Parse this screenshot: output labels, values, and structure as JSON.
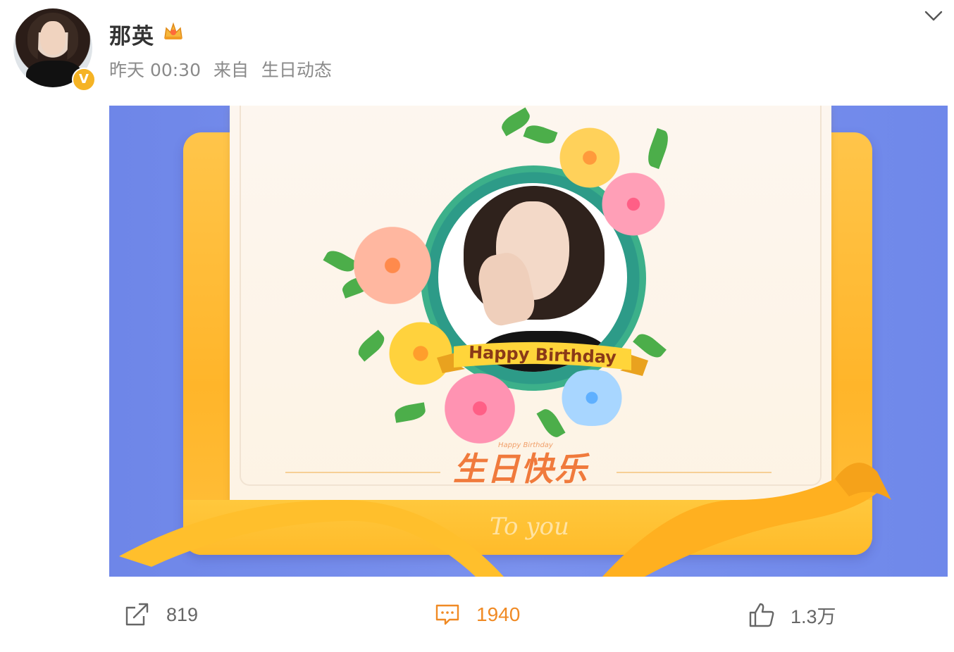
{
  "post": {
    "username": "那英",
    "time": "昨天 00:30",
    "source_prefix": "来自",
    "source": "生日动态",
    "verified_badge": "V"
  },
  "card": {
    "banner_text": "Happy Birthday",
    "title": "生日快乐",
    "subtitle": "Happy Birthday",
    "signature": "To you"
  },
  "actions": {
    "repost_count": "819",
    "comment_count": "1940",
    "like_count": "1.3万"
  },
  "colors": {
    "accent": "#f08a24",
    "background_blue": "#6e86e8",
    "envelope_yellow": "#ffc54a",
    "verified_gold": "#f5b324"
  },
  "icons": {
    "vip": "crown-icon",
    "menu": "chevron-down-icon",
    "repost": "share-icon",
    "comment": "comment-icon",
    "like": "thumbs-up-icon"
  }
}
